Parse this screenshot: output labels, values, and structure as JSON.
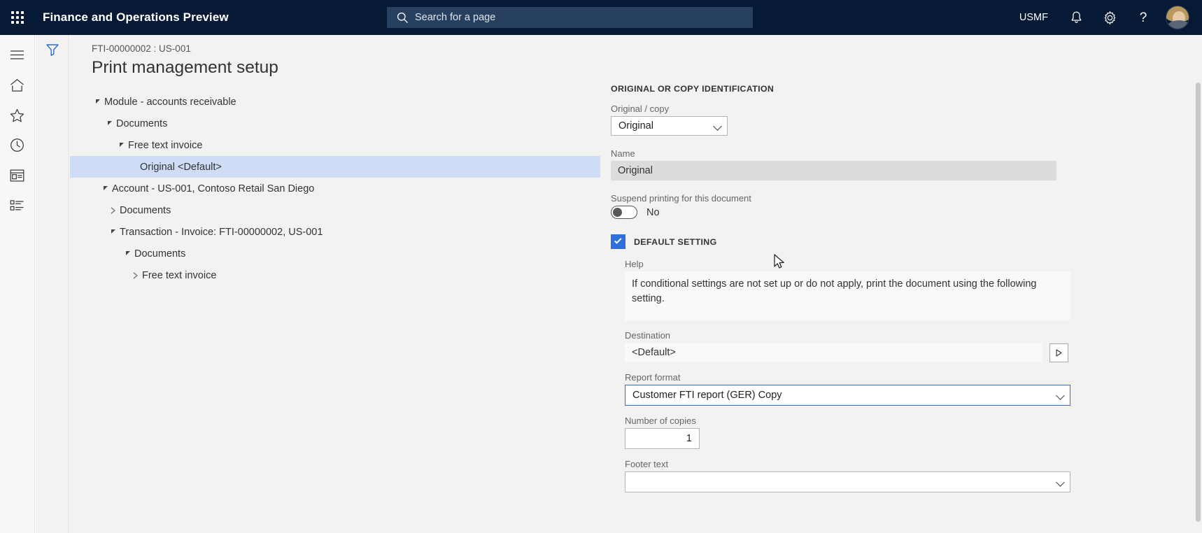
{
  "topnav": {
    "waffle_icon": "app-launcher-icon",
    "app_title": "Finance and Operations Preview",
    "search": {
      "icon": "search-icon",
      "placeholder": "Search for a page"
    },
    "company": "USMF",
    "notifications_icon": "bell-icon",
    "settings_icon": "gear-icon",
    "help_icon": "question-mark-icon",
    "avatar": "user-avatar"
  },
  "rail": {
    "items": [
      {
        "icon": "hamburger-menu-icon",
        "name": "expand-navigation"
      },
      {
        "icon": "home-icon",
        "name": "home"
      },
      {
        "icon": "star-icon",
        "name": "favorites"
      },
      {
        "icon": "clock-icon",
        "name": "recent"
      },
      {
        "icon": "workspace-icon",
        "name": "workspaces"
      },
      {
        "icon": "list-icon",
        "name": "modules"
      }
    ]
  },
  "filter_column": {
    "icon": "filter-icon"
  },
  "page": {
    "breadcrumb": "FTI-00000002 : US-001",
    "title": "Print management setup"
  },
  "tree": {
    "rows": [
      {
        "label": "Module - accounts receivable",
        "indent": 0,
        "state": "expanded",
        "selected": false
      },
      {
        "label": "Documents",
        "indent": 1,
        "state": "expanded",
        "selected": false
      },
      {
        "label": "Free text invoice",
        "indent": 2,
        "state": "expanded",
        "selected": false
      },
      {
        "label": "Original <Default>",
        "indent": 3,
        "state": "leaf",
        "selected": true
      },
      {
        "label": "Account - US-001, Contoso Retail San Diego",
        "indent": 1,
        "state": "expanded",
        "selected": false
      },
      {
        "label": "Documents",
        "indent": 2,
        "state": "collapsed",
        "selected": false
      },
      {
        "label": "Transaction - Invoice: FTI-00000002, US-001",
        "indent": 2,
        "state": "expanded",
        "selected": false
      },
      {
        "label": "Documents",
        "indent": 3,
        "state": "expanded",
        "selected": false
      },
      {
        "label": "Free text invoice",
        "indent": 4,
        "state": "collapsed",
        "selected": false
      }
    ]
  },
  "form": {
    "section_title": "ORIGINAL OR COPY IDENTIFICATION",
    "original_copy": {
      "label": "Original / copy",
      "value": "Original"
    },
    "name": {
      "label": "Name",
      "value": "Original"
    },
    "suspend": {
      "label": "Suspend printing for this document",
      "value": "No",
      "on": false
    },
    "default_setting": {
      "label": "DEFAULT SETTING",
      "checked": true
    },
    "help": {
      "label": "Help",
      "text": "If conditional settings are not set up or do not apply, print the document using the following setting."
    },
    "destination": {
      "label": "Destination",
      "value": "<Default>",
      "button_icon": "play-triangle-icon"
    },
    "report_format": {
      "label": "Report format",
      "value": "Customer FTI report (GER) Copy"
    },
    "number_of_copies": {
      "label": "Number of copies",
      "value": "1"
    },
    "footer_text": {
      "label": "Footer text",
      "value": ""
    }
  },
  "colors": {
    "nav_background": "#061A36",
    "search_background": "#28405F",
    "accent_blue": "#2f6fdd",
    "tree_selection": "#cfdcf5",
    "page_background": "#f2f2f0"
  }
}
